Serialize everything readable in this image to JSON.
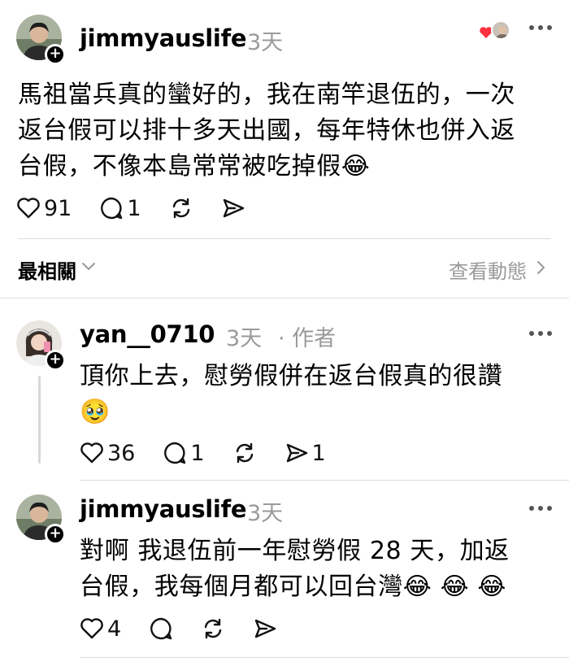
{
  "main_post": {
    "username": "jimmyauslife",
    "time": "3天",
    "text_lines": [
      "馬祖當兵真的蠻好的，我在南竿退伍的，一次",
      "返台假可以排十多天出國，每年特休也併入返",
      "台假，不像本島常常被吃掉假😂"
    ],
    "likes": "91",
    "replies": "1"
  },
  "sort": {
    "label": "最相關",
    "view_activity": "查看動態"
  },
  "replies": [
    {
      "username": "yan__0710",
      "time": "3天",
      "author_tag": "· 作者",
      "text_lines": [
        "頂你上去，慰勞假併在返台假真的很讚",
        "🥹"
      ],
      "likes": "36",
      "replies": "1",
      "shares": "1"
    },
    {
      "username": "jimmyauslife",
      "time": "3天",
      "text_lines": [
        "對啊 我退伍前一年慰勞假 28 天，加返",
        "台假，我每個月都可以回台灣😂 😂 😂"
      ],
      "likes": "4"
    }
  ],
  "colors": {
    "liked_heart": "#ff3040",
    "muted_text": "#9a9a9a"
  }
}
